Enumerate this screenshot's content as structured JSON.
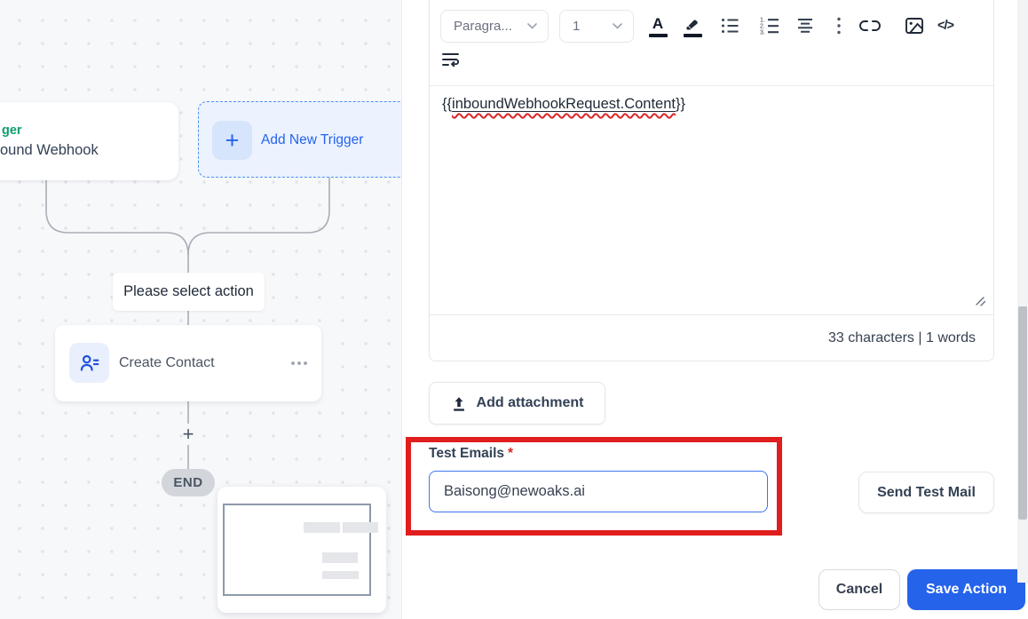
{
  "colors": {
    "accent_blue": "#2563eb",
    "trigger_green": "#0e9f6e",
    "annotation_red": "#e01e1e",
    "canvas_bg": "#f7f8fa"
  },
  "canvas": {
    "trigger_type_fragment": "ger",
    "trigger_name_fragment": "ound Webhook",
    "add_trigger_plus": "+",
    "add_trigger_label": "Add New Trigger",
    "select_action": "Please select action",
    "create_contact_label": "Create Contact",
    "add_step_plus": "+",
    "end_label": "END"
  },
  "toolbar": {
    "paragraph": "Paragra...",
    "size": "1",
    "font_color_glyph": "A",
    "code_glyph": "</>"
  },
  "editor": {
    "text_open": "{{",
    "text_variable": "inboundWebhookRequest.Content",
    "text_close": "}}",
    "stats": "33 characters | 1 words"
  },
  "attachment": {
    "label": "Add attachment"
  },
  "test_emails": {
    "label": "Test Emails",
    "required_mark": "*",
    "value": "Baisong@newoaks.ai"
  },
  "footer_actions": {
    "send_test": "Send Test Mail",
    "cancel": "Cancel",
    "save": "Save Action"
  }
}
